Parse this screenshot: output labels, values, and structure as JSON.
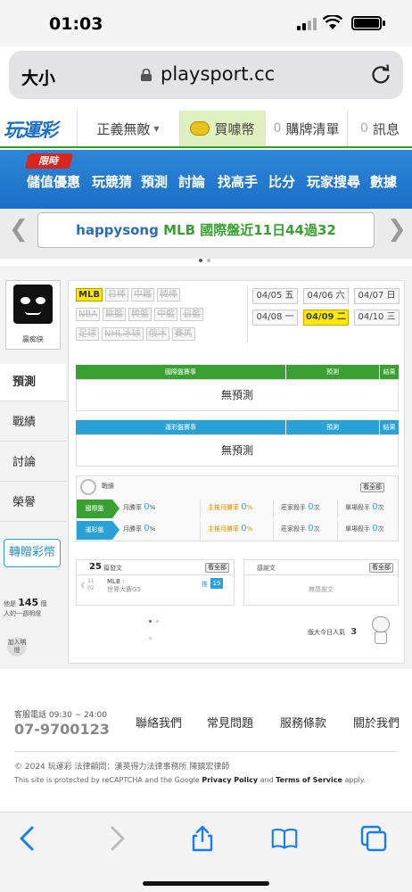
{
  "status_bar": {
    "time": "01:03"
  },
  "browser": {
    "text_size_label": "大小",
    "url": "playsport.cc"
  },
  "site_nav": {
    "logo_text": "玩運彩",
    "user_menu": "正義無敵",
    "coin_label": "買噱幣",
    "cart_count": "0",
    "cart_label": "購牌清單",
    "msg_count": "0",
    "msg_label": "訊息"
  },
  "menu": {
    "sale_badge": "限時",
    "items": [
      "儲值優惠",
      "玩競猜",
      "預測",
      "討論",
      "找高手",
      "比分",
      "玩家搜尋",
      "數據"
    ]
  },
  "ticker": {
    "user": "happysong",
    "text": "MLB 國際盤近11日44過32"
  },
  "profile": {
    "username": "贏痴侠",
    "tabs": [
      "預測",
      "戰績",
      "討論",
      "榮譽"
    ],
    "gift_button": "轉贈彩幣",
    "count_prefix": "他是",
    "count_value": "145",
    "count_suffix": "個",
    "count_note": "人的一週明燈",
    "add_button": "加入明燈"
  },
  "leagues": {
    "row1": [
      "MLB",
      "日棒",
      "中職",
      "韓棒"
    ],
    "row2": [
      "NBA",
      "歐籃",
      "韓籃",
      "中籃",
      "日籃"
    ],
    "row3": [
      "足球",
      "NHL冰球",
      "俄冰",
      "賽馬"
    ]
  },
  "dates": [
    {
      "label": "04/05 五",
      "selected": false
    },
    {
      "label": "04/06 六",
      "selected": false
    },
    {
      "label": "04/07 日",
      "selected": false
    },
    {
      "label": "04/08 一",
      "selected": false
    },
    {
      "label": "04/09 二",
      "selected": true
    },
    {
      "label": "04/10 三",
      "selected": false
    }
  ],
  "intl_table": {
    "header": "國際盤賽事",
    "col2": "預測",
    "col3": "結果",
    "empty": "無預測"
  },
  "lottery_table": {
    "header": "運彩盤賽事",
    "col2": "預測",
    "col3": "結果",
    "empty": "無預測"
  },
  "record": {
    "title": "戰績",
    "view_all": "看全部",
    "rows": [
      {
        "name": "國際盤",
        "color": "#3aa032",
        "month_label": "月勝率",
        "month_val": "0",
        "main_label": "主推月勝率",
        "main_val": "0",
        "banker_label": "莊家殺手",
        "banker_val": "0",
        "single_label": "單場殺手",
        "single_val": "0"
      },
      {
        "name": "運彩盤",
        "color": "#2aa2d8",
        "month_label": "月勝率",
        "month_val": "0",
        "main_label": "主推月勝率",
        "main_val": "0",
        "banker_label": "莊家殺手",
        "banker_val": "0",
        "single_label": "單場殺手",
        "single_val": "0"
      }
    ],
    "pct_sign": "%",
    "times": "次"
  },
  "posts": {
    "count": "25",
    "title": "篇發文",
    "view_all": "看全部",
    "date_month": "11",
    "date_day": "02",
    "item_league": "MLB :",
    "item_title": "世界大賽G5",
    "item_tag": "推",
    "item_count": "19"
  },
  "thanks": {
    "title": "感謝文",
    "view_all": "看全部",
    "empty": "無感謝文"
  },
  "popularity": {
    "label": "版大今日人氣",
    "value": "3"
  },
  "footer": {
    "service_label": "客服電話 09:30 ~ 24:00",
    "phone": "07-9700123",
    "links": [
      "聯絡我們",
      "常見問題",
      "服務條款",
      "關於我們"
    ],
    "copyright": "© 2024 玩運彩 法律顧問：漢英得力法律事務所 陳鎮宏律師",
    "recaptcha_pre": "This site is protected by reCAPTCHA and the Google",
    "privacy": "Privacy Policy",
    "and": "and",
    "terms": "Terms of Service",
    "apply": "apply."
  }
}
